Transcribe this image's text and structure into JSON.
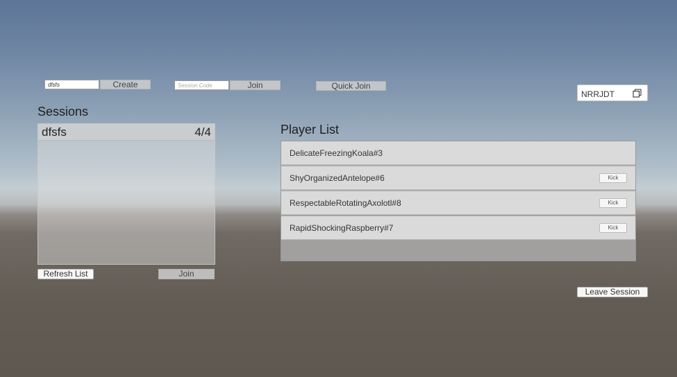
{
  "create": {
    "input_value": "dfsfs",
    "button_label": "Create"
  },
  "join_by_code": {
    "placeholder": "Session Code",
    "button_label": "Join"
  },
  "quick_join": {
    "button_label": "Quick Join"
  },
  "session_code": {
    "value": "NRRJDT",
    "copy_icon": "copy-icon"
  },
  "sessions": {
    "title": "Sessions",
    "items": [
      {
        "name": "dfsfs",
        "count": "4/4"
      }
    ],
    "refresh_label": "Refresh List",
    "join_label": "Join"
  },
  "players": {
    "title": "Player List",
    "items": [
      {
        "name": "DelicateFreezingKoala#3",
        "kick_label": ""
      },
      {
        "name": "ShyOrganizedAntelope#6",
        "kick_label": "Kick"
      },
      {
        "name": "RespectableRotatingAxolotl#8",
        "kick_label": "Kick"
      },
      {
        "name": "RapidShockingRaspberry#7",
        "kick_label": "Kick"
      }
    ]
  },
  "leave_label": "Leave Session"
}
